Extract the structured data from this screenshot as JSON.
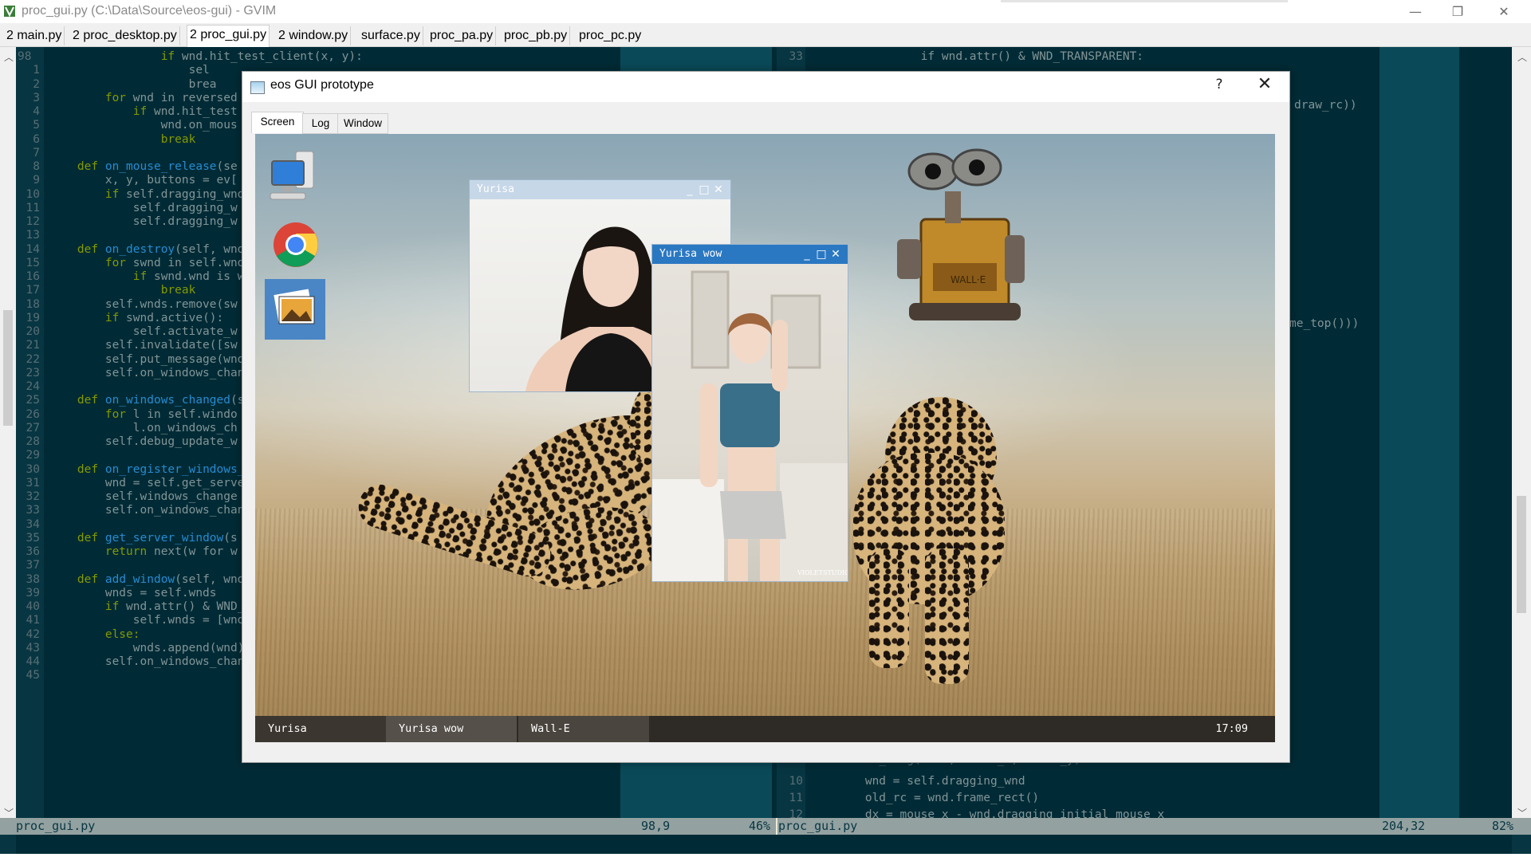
{
  "gvim": {
    "title": "proc_gui.py (C:\\Data\\Source\\eos-gui) - GVIM",
    "tabs": [
      "2 main.py",
      "2 proc_desktop.py",
      "2 proc_gui.py",
      "2 window.py",
      "surface.py",
      "proc_pa.py",
      "proc_pb.py",
      "proc_pc.py"
    ],
    "active_tab_index": 2,
    "left_pane": {
      "top_line_number": "98",
      "line_numbers": [
        "1",
        "2",
        "3",
        "4",
        "5",
        "6",
        "7",
        "8",
        "9",
        "10",
        "11",
        "12",
        "13",
        "14",
        "15",
        "16",
        "17",
        "18",
        "19",
        "20",
        "21",
        "22",
        "23",
        "24",
        "25",
        "26",
        "27",
        "28",
        "29",
        "30",
        "31",
        "32",
        "33",
        "34",
        "35",
        "36",
        "37",
        "38",
        "39",
        "40",
        "41",
        "42",
        "43",
        "44",
        "45"
      ],
      "lines": [
        "                if wnd.hit_test_client(x, y):",
        "                    sel",
        "                    brea",
        "        for wnd in reversed",
        "            if wnd.hit_test",
        "                wnd.on_mous",
        "                break",
        "",
        "    def on_mouse_release(se",
        "        x, y, buttons = ev[",
        "        if self.dragging_wnd",
        "            self.dragging_w",
        "            self.dragging_w",
        "",
        "    def on_destroy(self, wnd",
        "        for swnd in self.wnd",
        "            if swnd.wnd is w",
        "                break",
        "        self.wnds.remove(sw",
        "        if swnd.active():",
        "            self.activate_w",
        "        self.invalidate([sw",
        "        self.put_message(wnd",
        "        self.on_windows_chan",
        "",
        "    def on_windows_changed(s",
        "        for l in self.windo",
        "            l.on_windows_ch",
        "        self.debug_update_w",
        "",
        "    def on_register_windows_",
        "        wnd = self.get_serve",
        "        self.windows_change",
        "        self.on_windows_chan",
        "",
        "    def get_server_window(s",
        "        return next(w for w",
        "",
        "    def add_window(self, wnd",
        "        wnds = self.wnds",
        "        if wnd.attr() & WND_",
        "            self.wnds = [wnd",
        "        else:",
        "            wnds.append(wnd)",
        "        self.on_windows_changed()",
        ""
      ]
    },
    "right_pane": {
      "visible_lines": [
        {
          "num": "33",
          "code": "                if wnd.attr() & WND_TRANSPARENT:"
        },
        {
          "num": "10",
          "code": "        wnd = self.dragging_wnd"
        },
        {
          "num": "11",
          "code": "        old_rc = wnd.frame_rect()"
        },
        {
          "num": "12",
          "code": "        dx = mouse_x - wnd.dragging_initial_mouse_x"
        }
      ],
      "partial_right_1": "draw_rc))",
      "partial_right_2": "me_top()))",
      "partial_bottom": "    def do_drag(self, mouse_x, mouse_y):"
    },
    "status": {
      "left_file": "proc_gui.py",
      "left_pos": "98,9",
      "left_pct": "46%",
      "right_file": "proc_gui.py",
      "right_pos": "204,32",
      "right_pct": "82%"
    }
  },
  "dialog": {
    "title": "eos GUI prototype",
    "help": "?",
    "close": "✕",
    "tabs": [
      "Screen",
      "Log",
      "Window"
    ],
    "active_tab_index": 0
  },
  "screen": {
    "desktop_icons": [
      "computer-icon",
      "chrome-icon",
      "photos-icon"
    ],
    "windows": [
      {
        "title": "Yurisa",
        "active": false
      },
      {
        "title": "Yurisa wow",
        "active": true
      }
    ],
    "taskbar": {
      "items": [
        "Yurisa",
        "Yurisa wow",
        "Wall-E"
      ],
      "clock": "17:09"
    },
    "photo_watermark": "VIOLETSTUDIO"
  },
  "colors": {
    "vim_bg": "#002b36",
    "vim_gutter": "#073642",
    "vim_text": "#839496",
    "vim_keyword": "#859900",
    "vim_function": "#268bd2",
    "status_bg": "#93a1a1",
    "active_window_title": "#2b78c2",
    "inactive_window_title": "#c6d7e8",
    "taskbar": "#2e2a25"
  }
}
